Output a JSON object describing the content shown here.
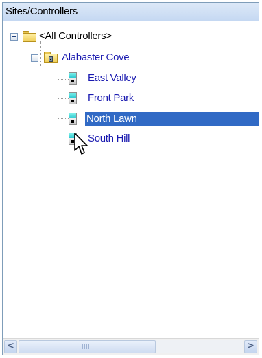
{
  "panel": {
    "title": "Sites/Controllers"
  },
  "tree": {
    "root": {
      "label": "<All Controllers>",
      "icon": "folder-icon",
      "expanded": true
    },
    "site": {
      "label": "Alabaster Cove",
      "icon": "site-folder-icon",
      "expanded": true
    },
    "controllers": [
      {
        "label": "East Valley",
        "icon": "controller-icon",
        "selected": false
      },
      {
        "label": "Front Park",
        "icon": "controller-icon",
        "selected": false
      },
      {
        "label": "North Lawn",
        "icon": "controller-icon",
        "selected": true
      },
      {
        "label": "South Hill",
        "icon": "controller-icon",
        "selected": false
      }
    ]
  },
  "scrollbar": {
    "left_arrow": "<",
    "right_arrow": ">"
  },
  "colors": {
    "selection": "#316ac5",
    "link_text": "#1a1ab0",
    "header_bg": "#c5d8f2"
  }
}
